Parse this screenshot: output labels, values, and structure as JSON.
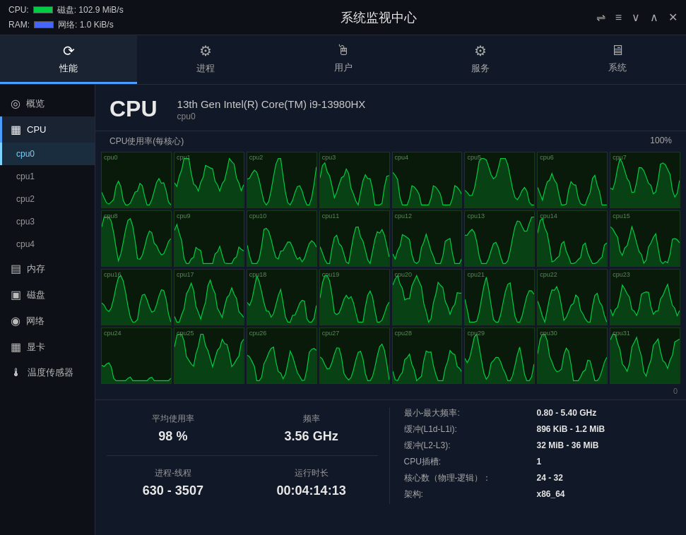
{
  "topbar": {
    "title": "系统监视中心",
    "cpu_label": "CPU:",
    "ram_label": "RAM:",
    "disk_stat": "磁盘: 102.9 MiB/s",
    "net_stat": "网络: 1.0 KiB/s"
  },
  "tabs": [
    {
      "label": "性能",
      "icon": "⟳",
      "active": true
    },
    {
      "label": "进程",
      "icon": "⚙"
    },
    {
      "label": "用户",
      "icon": "🖱"
    },
    {
      "label": "服务",
      "icon": "⚙"
    },
    {
      "label": "系统",
      "icon": "🖥"
    }
  ],
  "sidebar": {
    "items": [
      {
        "label": "概览",
        "icon": "◎",
        "active": false
      },
      {
        "label": "CPU",
        "icon": "▦",
        "active": true
      },
      {
        "label": "cpu0",
        "sub": true,
        "active": true
      },
      {
        "label": "cpu1",
        "sub": true
      },
      {
        "label": "cpu2",
        "sub": true
      },
      {
        "label": "cpu3",
        "sub": true
      },
      {
        "label": "cpu4",
        "sub": true
      },
      {
        "label": "内存",
        "icon": "▤"
      },
      {
        "label": "磁盘",
        "icon": "▣"
      },
      {
        "label": "网络",
        "icon": "◉"
      },
      {
        "label": "显卡",
        "icon": "▦"
      },
      {
        "label": "温度传感器",
        "icon": "🌡"
      }
    ]
  },
  "cpu": {
    "title": "CPU",
    "model": "13th Gen Intel(R) Core(TM) i9-13980HX",
    "submodel": "cpu0",
    "usage_label": "CPU使用率(每核心)",
    "percent_max": "100%",
    "zero": "0",
    "cores": [
      "cpu0",
      "cpu1",
      "cpu2",
      "cpu3",
      "cpu4",
      "cpu5",
      "cpu6",
      "cpu7",
      "cpu8",
      "cpu9",
      "cpu10",
      "cpu11",
      "cpu12",
      "cpu13",
      "cpu14",
      "cpu15",
      "cpu16",
      "cpu17",
      "cpu18",
      "cpu19",
      "cpu20",
      "cpu21",
      "cpu22",
      "cpu23",
      "cpu24",
      "cpu25",
      "cpu26",
      "cpu27",
      "cpu28",
      "cpu29",
      "cpu30",
      "cpu31"
    ]
  },
  "stats": {
    "avg_label": "平均使用率",
    "avg_value": "98 %",
    "freq_label": "频率",
    "freq_value": "3.56 GHz",
    "proc_label": "进程-线程",
    "proc_value": "630 - 3507",
    "uptime_label": "运行时长",
    "uptime_value": "00:04:14:13",
    "info": [
      {
        "key": "最小-最大频率:",
        "val": "0.80 - 5.40 GHz"
      },
      {
        "key": "缓冲(L1d-L1i):",
        "val": "896 KiB - 1.2 MiB"
      },
      {
        "key": "缓冲(L2-L3):",
        "val": "32 MiB - 36 MiB"
      },
      {
        "key": "CPU插槽:",
        "val": "1"
      },
      {
        "key": "核心数（物理-逻辑）：",
        "val": "24 - 32"
      },
      {
        "key": "架构:",
        "val": "x86_64"
      }
    ]
  }
}
